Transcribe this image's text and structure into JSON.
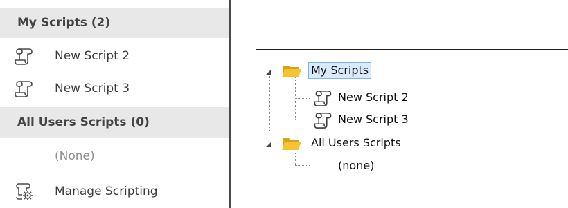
{
  "menu": {
    "sections": [
      {
        "header": "My Scripts (2)",
        "items": [
          {
            "label": "New Script 2",
            "icon": "script-icon",
            "enabled": true
          },
          {
            "label": "New Script 3",
            "icon": "script-icon",
            "enabled": true
          }
        ]
      },
      {
        "header": "All Users Scripts (0)",
        "items": [
          {
            "label": "(None)",
            "icon": "",
            "enabled": false
          }
        ]
      }
    ],
    "footer_item": {
      "label": "Manage Scripting",
      "icon": "manage-scripting-icon"
    }
  },
  "tree": {
    "nodes": [
      {
        "label": "My Scripts",
        "icon": "folder-icon",
        "expanded": true,
        "selected": true,
        "children": [
          {
            "label": "New Script 2",
            "icon": "script-icon"
          },
          {
            "label": "New Script 3",
            "icon": "script-icon"
          }
        ]
      },
      {
        "label": "All Users Scripts",
        "icon": "folder-icon",
        "expanded": true,
        "selected": false,
        "children": [
          {
            "label": "(none)",
            "icon": ""
          }
        ]
      }
    ]
  },
  "colors": {
    "menu_header_bg": "#e8e8e8",
    "selection_bg": "#d9ebfb",
    "selection_border": "#7eb4ea",
    "folder": "#f5c430"
  }
}
